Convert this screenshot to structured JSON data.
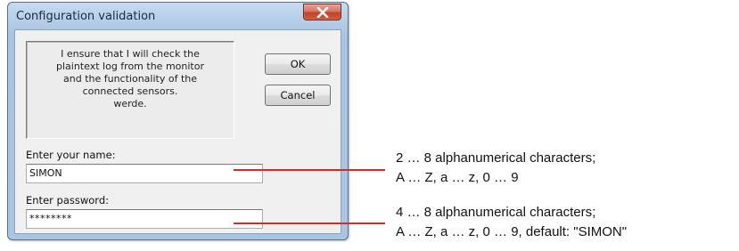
{
  "dialog": {
    "title": "Configuration validation",
    "message_lines": [
      "I ensure that I will check the",
      "plaintext log from the monitor",
      "and the functionality of the",
      "connected sensors.",
      "werde."
    ],
    "ok_label": "OK",
    "cancel_label": "Cancel",
    "name_label": "Enter your name:",
    "name_value": "SIMON",
    "password_label": "Enter password:",
    "password_value": "********"
  },
  "annotations": {
    "name_rule_line1": "2 … 8 alphanumerical characters;",
    "name_rule_line2": "A … Z, a … z, 0 … 9",
    "password_rule_line1": "4 … 8 alphanumerical characters;",
    "password_rule_line2": "A … Z, a … z, 0 … 9, default: \"SIMON\"",
    "callout_color": "#d62a24"
  },
  "icons": {
    "close": "close-icon"
  }
}
